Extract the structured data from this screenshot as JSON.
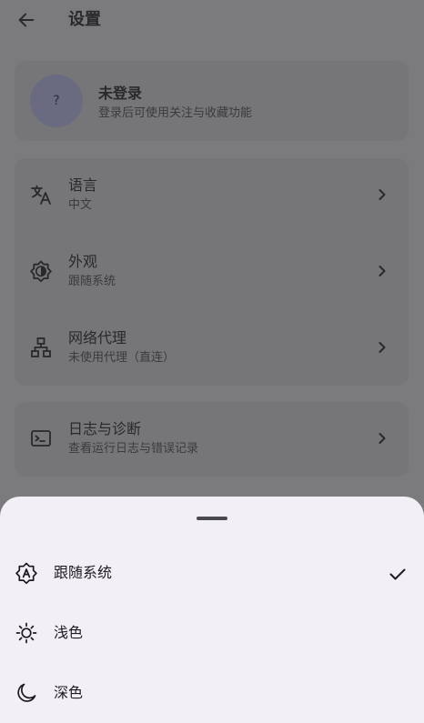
{
  "header": {
    "title": "设置"
  },
  "account": {
    "avatar_text": "?",
    "title": "未登录",
    "subtitle": "登录后可使用关注与收藏功能"
  },
  "settings": [
    {
      "title": "语言",
      "subtitle": "中文",
      "icon": "translate-icon"
    },
    {
      "title": "外观",
      "subtitle": "跟随系统",
      "icon": "brightness-icon"
    },
    {
      "title": "网络代理",
      "subtitle": "未使用代理（直连）",
      "icon": "network-tree-icon"
    }
  ],
  "diagnostics": {
    "title": "日志与诊断",
    "subtitle": "查看运行日志与错误记录",
    "icon": "terminal-icon"
  },
  "appearance_sheet": {
    "options": [
      {
        "label": "跟随系统",
        "icon": "auto-brightness-icon",
        "selected": true
      },
      {
        "label": "浅色",
        "icon": "sun-icon",
        "selected": false
      },
      {
        "label": "深色",
        "icon": "moon-icon",
        "selected": false
      }
    ]
  },
  "colors": {
    "scrim_background": "#7b7b7d",
    "card_background": "#767679",
    "sheet_background": "#f2eff6",
    "avatar_background": "#6a6b80"
  }
}
